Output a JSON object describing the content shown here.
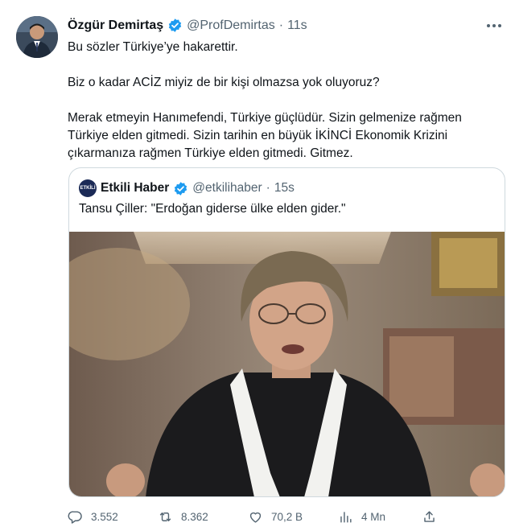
{
  "tweet": {
    "author_name": "Özgür Demirtaş",
    "handle": "@ProfDemirtas",
    "separator": "·",
    "time": "11s",
    "paragraphs": [
      "Bu sözler Türkiye’ye hakarettir.",
      "Biz o kadar ACİZ miyiz de bir kişi olmazsa yok oluyoruz?",
      "Merak etmeyin Hanımefendi, Türkiye güçlüdür. Sizin gelmenize rağmen Türkiye elden gitmedi. Sizin tarihin en büyük İKİNCİ Ekonomik Krizini çıkarmanıza rağmen Türkiye elden gitmedi. Gitmez."
    ]
  },
  "quoted": {
    "author_name": "Etkili Haber",
    "handle": "@etkilihaber",
    "separator": "·",
    "time": "15s",
    "avatar_text": "ETKİLİ",
    "text": "Tansu Çiller: \"Erdoğan giderse ülke elden gider.\""
  },
  "actions": {
    "replies": "3.552",
    "retweets": "8.362",
    "likes": "70,2 B",
    "views": "4 Mn"
  },
  "colors": {
    "text": "#0f1419",
    "secondary": "#536471",
    "verified": "#1d9bf0",
    "border": "#cfd9de"
  },
  "icons": [
    "verified-badge-icon",
    "more-icon",
    "reply-icon",
    "retweet-icon",
    "like-icon",
    "views-icon",
    "share-icon"
  ]
}
